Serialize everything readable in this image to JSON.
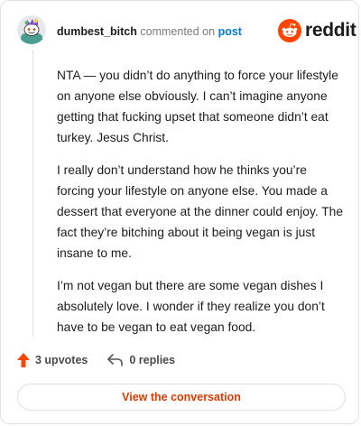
{
  "header": {
    "username": "dumbest_bitch",
    "commented_text": "commented on",
    "post_link": "post",
    "brand": "reddit"
  },
  "comment": {
    "paragraphs": [
      "NTA — you didn’t do anything to force your lifestyle on anyone else obviously. I can’t imagine anyone getting that fucking upset that someone didn’t eat turkey. Jesus Christ.",
      "I really don’t understand how he thinks you’re forcing your lifestyle on anyone else. You made a dessert that everyone at the dinner could enjoy. The fact they’re bitching about it being vegan is just insane to me.",
      "I’m not vegan but there are some vegan dishes I absolutely love. I wonder if they realize you don’t have to be vegan to eat vegan food."
    ]
  },
  "actions": {
    "upvotes": "3 upvotes",
    "replies": "0 replies"
  },
  "footer": {
    "view_button": "View the conversation"
  },
  "colors": {
    "accent_orange": "#ff4500",
    "link_blue": "#0079d3",
    "button_text": "#d93a00"
  },
  "icons": {
    "avatar": "snoo-avatar",
    "logo": "reddit-snoo-logo",
    "upvote": "upvote-arrow-icon",
    "reply": "reply-arrow-icon"
  }
}
